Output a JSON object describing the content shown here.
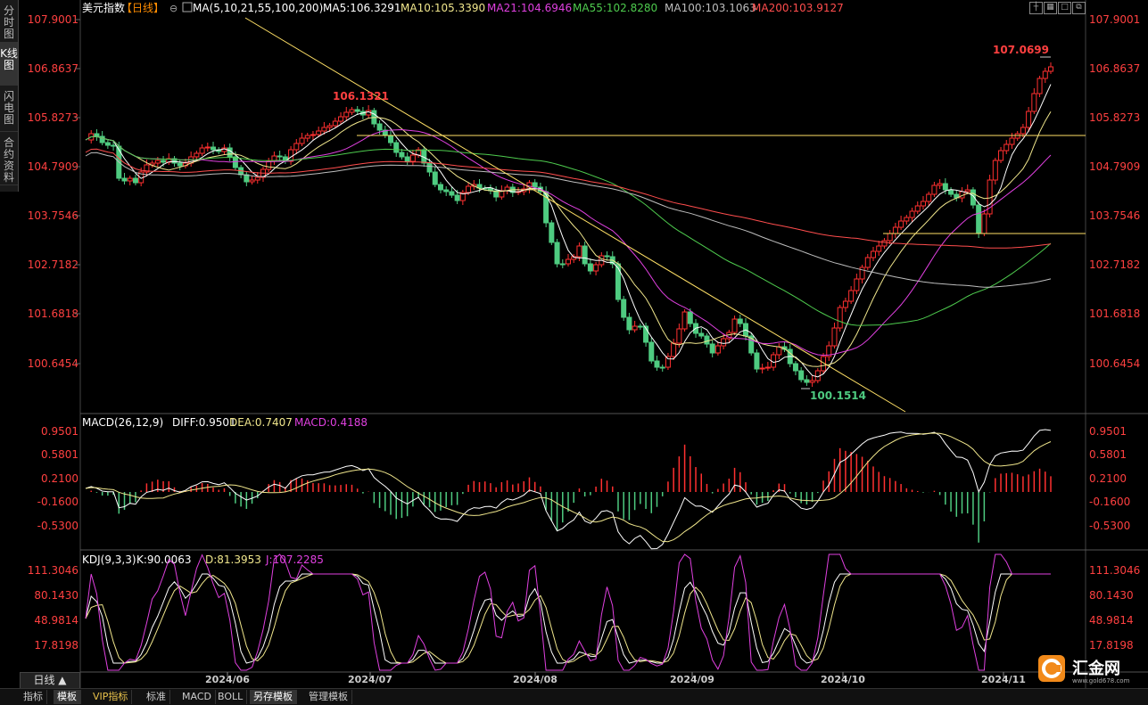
{
  "side_tabs": [
    {
      "label": "分时图"
    },
    {
      "label": "K线图"
    },
    {
      "label": "闪电图"
    },
    {
      "label": "合约资料"
    }
  ],
  "header": {
    "symbol": "美元指数",
    "period_tag": "【日线】",
    "ma_items": [
      {
        "label": "MA(5,10,21,55,100,200)",
        "color": "#ffffff"
      },
      {
        "label": "MA5:106.3291",
        "color": "#ffffff"
      },
      {
        "label": "MA10:105.3390",
        "color": "#f0e68c"
      },
      {
        "label": "MA21:104.6946",
        "color": "#e040e0"
      },
      {
        "label": "MA55:102.8280",
        "color": "#4ecb4e"
      },
      {
        "label": "MA100:103.1063",
        "color": "#bdbdbd"
      },
      {
        "label": "MA200:103.9127",
        "color": "#ff4d4d"
      }
    ]
  },
  "price_axis": [
    "107.9001",
    "106.8637",
    "105.8273",
    "104.7909",
    "103.7546",
    "102.7182",
    "101.6818",
    "100.6454"
  ],
  "annotations": {
    "high": "107.0699",
    "low": "100.1514",
    "mid_high": "106.1321"
  },
  "macd": {
    "title": "MACD(26,12,9)",
    "diff": "DIFF:0.9501",
    "dea": "DEA:0.7407",
    "macd": "MACD:0.4188",
    "axis": [
      "0.9501",
      "0.5801",
      "0.2100",
      "-0.1600",
      "-0.5300"
    ]
  },
  "kdj": {
    "title": "KDJ(9,3,3)",
    "k": "K:90.0063",
    "d": "D:81.3953",
    "j": "J:107.2285",
    "axis": [
      "111.3046",
      "80.1430",
      "48.9814",
      "17.8198"
    ]
  },
  "time_axis": [
    "2024/06",
    "2024/07",
    "2024/08",
    "2024/09",
    "2024/10",
    "2024/11"
  ],
  "period_selector": "日线 ▲",
  "bottom_tabs": [
    {
      "label": "指标"
    },
    {
      "label": "模板"
    },
    {
      "label": "VIP指标"
    },
    {
      "label": "标准"
    },
    {
      "label": "MACD"
    },
    {
      "label": "BOLL"
    },
    {
      "label": "另存模板"
    },
    {
      "label": "管理模板"
    }
  ],
  "logo": {
    "name": "汇金网",
    "url": "www.gold678.com"
  },
  "colors": {
    "up": "#ff3030",
    "down": "#4ecb80",
    "axis_text": "#ff4040",
    "grid": "#2a2a2a"
  },
  "toolbar_icons": [
    "crosshair-icon",
    "layout-icon",
    "maximize-icon",
    "restore-icon"
  ]
}
